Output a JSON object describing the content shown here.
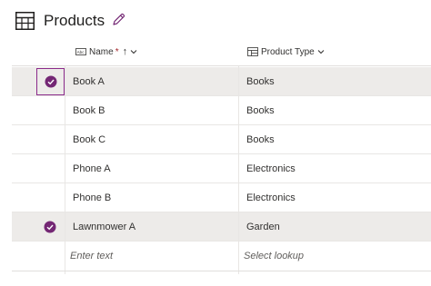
{
  "header": {
    "title": "Products",
    "icon": "table-icon",
    "edit_icon": "pencil-icon"
  },
  "columns": {
    "name": {
      "label": "Name",
      "required_marker": "*",
      "sort_indicator": "↑",
      "icon": "text-field-icon"
    },
    "product_type": {
      "label": "Product Type",
      "icon": "lookup-field-icon"
    }
  },
  "rows": [
    {
      "name": "Book A",
      "product_type": "Books",
      "selected": true
    },
    {
      "name": "Book B",
      "product_type": "Books",
      "selected": false
    },
    {
      "name": "Book C",
      "product_type": "Books",
      "selected": false
    },
    {
      "name": "Phone A",
      "product_type": "Electronics",
      "selected": false
    },
    {
      "name": "Phone B",
      "product_type": "Electronics",
      "selected": false
    },
    {
      "name": "Lawnmower A",
      "product_type": "Garden",
      "selected": true
    }
  ],
  "new_row": {
    "name_placeholder": "Enter text",
    "type_placeholder": "Select lookup"
  },
  "colors": {
    "accent": "#742774",
    "selected_row_bg": "#edebe9",
    "focus_border": "#8b2a8b"
  }
}
